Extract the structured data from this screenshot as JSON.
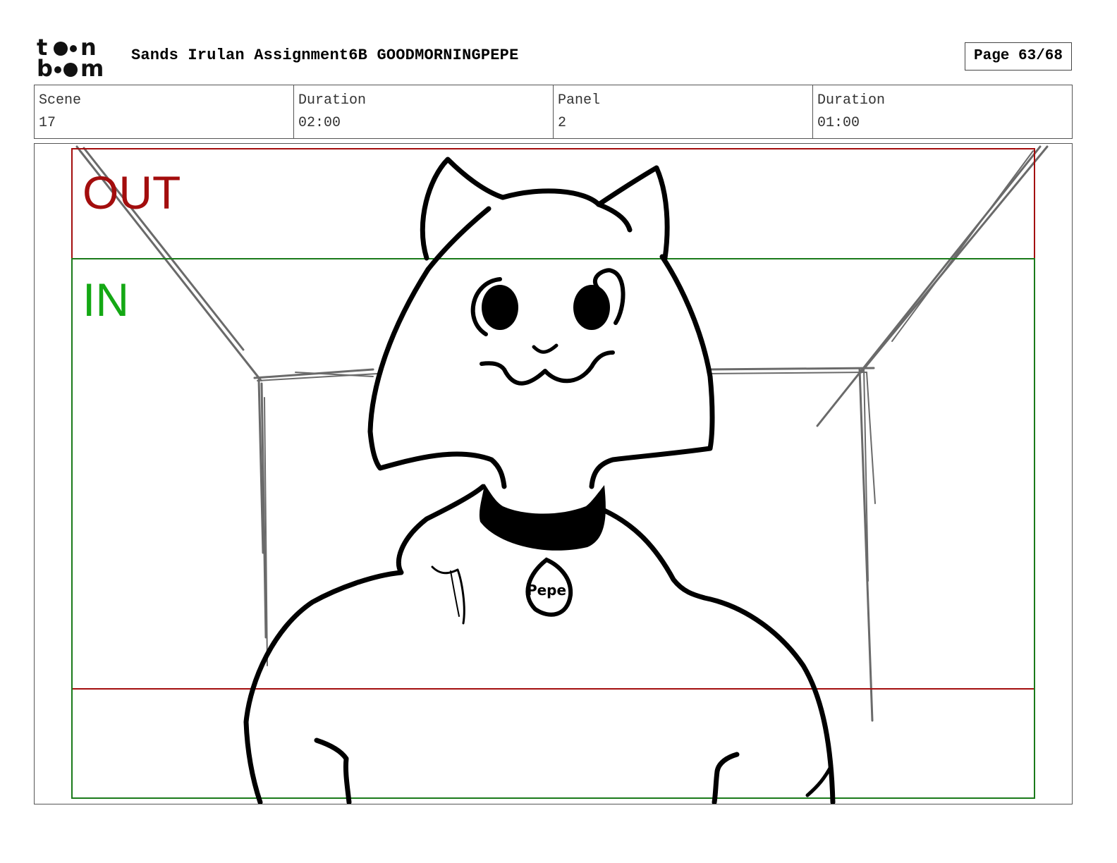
{
  "header": {
    "logo_text": "toon boom",
    "title": "Sands Irulan Assignment6B GOODMORNINGPEPE",
    "page": "Page 63/68"
  },
  "info": [
    {
      "label": "Scene",
      "value": "17"
    },
    {
      "label": "Duration",
      "value": "02:00"
    },
    {
      "label": "Panel",
      "value": "2"
    },
    {
      "label": "Duration",
      "value": "01:00"
    }
  ],
  "panel": {
    "out_label": "OUT",
    "in_label": "IN",
    "tag_text": "Pepe"
  },
  "colors": {
    "out_frame": "#a30d0d",
    "in_frame": "#1a7a1a",
    "out_text": "#a30d0d",
    "in_text": "#14a814",
    "sketch": "#6a6a6a"
  }
}
